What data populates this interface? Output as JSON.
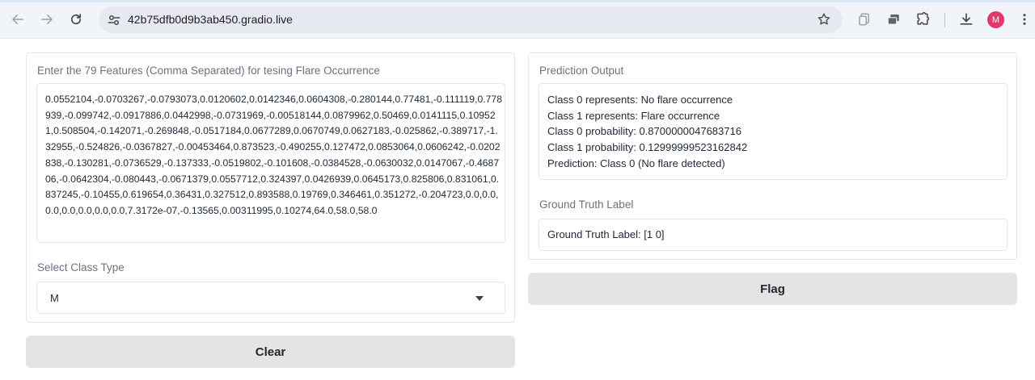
{
  "browser": {
    "url": "42b75dfb0d9b3ab450.gradio.live",
    "profile_initial": "M",
    "icons": {
      "back": "arrow-left-icon",
      "forward": "arrow-right-icon",
      "reload": "reload-icon",
      "site_info": "site-info-icon",
      "bookmark": "star-icon",
      "extensions": "puzzle-icon",
      "download": "download-icon",
      "menu": "kebab-menu-icon"
    }
  },
  "input_panel": {
    "features_label": "Enter the 79 Features (Comma Separated) for tesing Flare Occurrence",
    "features_value": "0.0552104,-0.0703267,-0.0793073,0.0120602,0.0142346,0.0604308,-0.280144,0.77481,-0.111119,0.778939,-0.099742,-0.0917886,0.0442998,-0.0731969,-0.00518144,0.0879962,0.50469,0.0141115,0.109521,0.508504,-0.142071,-0.269848,-0.0517184,0.0677289,0.0670749,0.0627183,-0.025862,-0.389717,-1.32955,-0.524826,-0.0367827,-0.00453464,0.873523,-0.490255,0.127472,0.0853064,0.0606242,-0.0202838,-0.130281,-0.0736529,-0.137333,-0.0519802,-0.101608,-0.0384528,-0.0630032,0.0147067,-0.468706,-0.0642304,-0.080443,-0.0671379,0.0557712,0.324397,0.0426939,0.0645173,0.825806,0.831061,0.837245,-0.10455,0.619654,0.36431,0.327512,0.893588,0.19769,0.346461,0.351272,-0.204723,0.0,0.0,0.0,0.0,0.0,0.0,0.0,7.3172e-07,-0.13565,0.00311995,0.10274,64.0,58.0,58.0",
    "class_label": "Select Class Type",
    "class_value": "M",
    "clear_label": "Clear"
  },
  "output_panel": {
    "prediction_label": "Prediction Output",
    "prediction_lines": [
      "Class 0 represents: No flare occurrence",
      "Class 1 represents: Flare occurrence",
      "Class 0 probability: 0.8700000047683716",
      "Class 1 probability: 0.12999999523162842",
      "Prediction: Class 0 (No flare detected)"
    ],
    "ground_truth_label": "Ground Truth Label",
    "ground_truth_value": "Ground Truth Label: [1 0]",
    "flag_label": "Flag"
  },
  "colors": {
    "avatar": "#e8356d",
    "button_bg": "#e4e4e7",
    "label_text": "#6b7280"
  }
}
